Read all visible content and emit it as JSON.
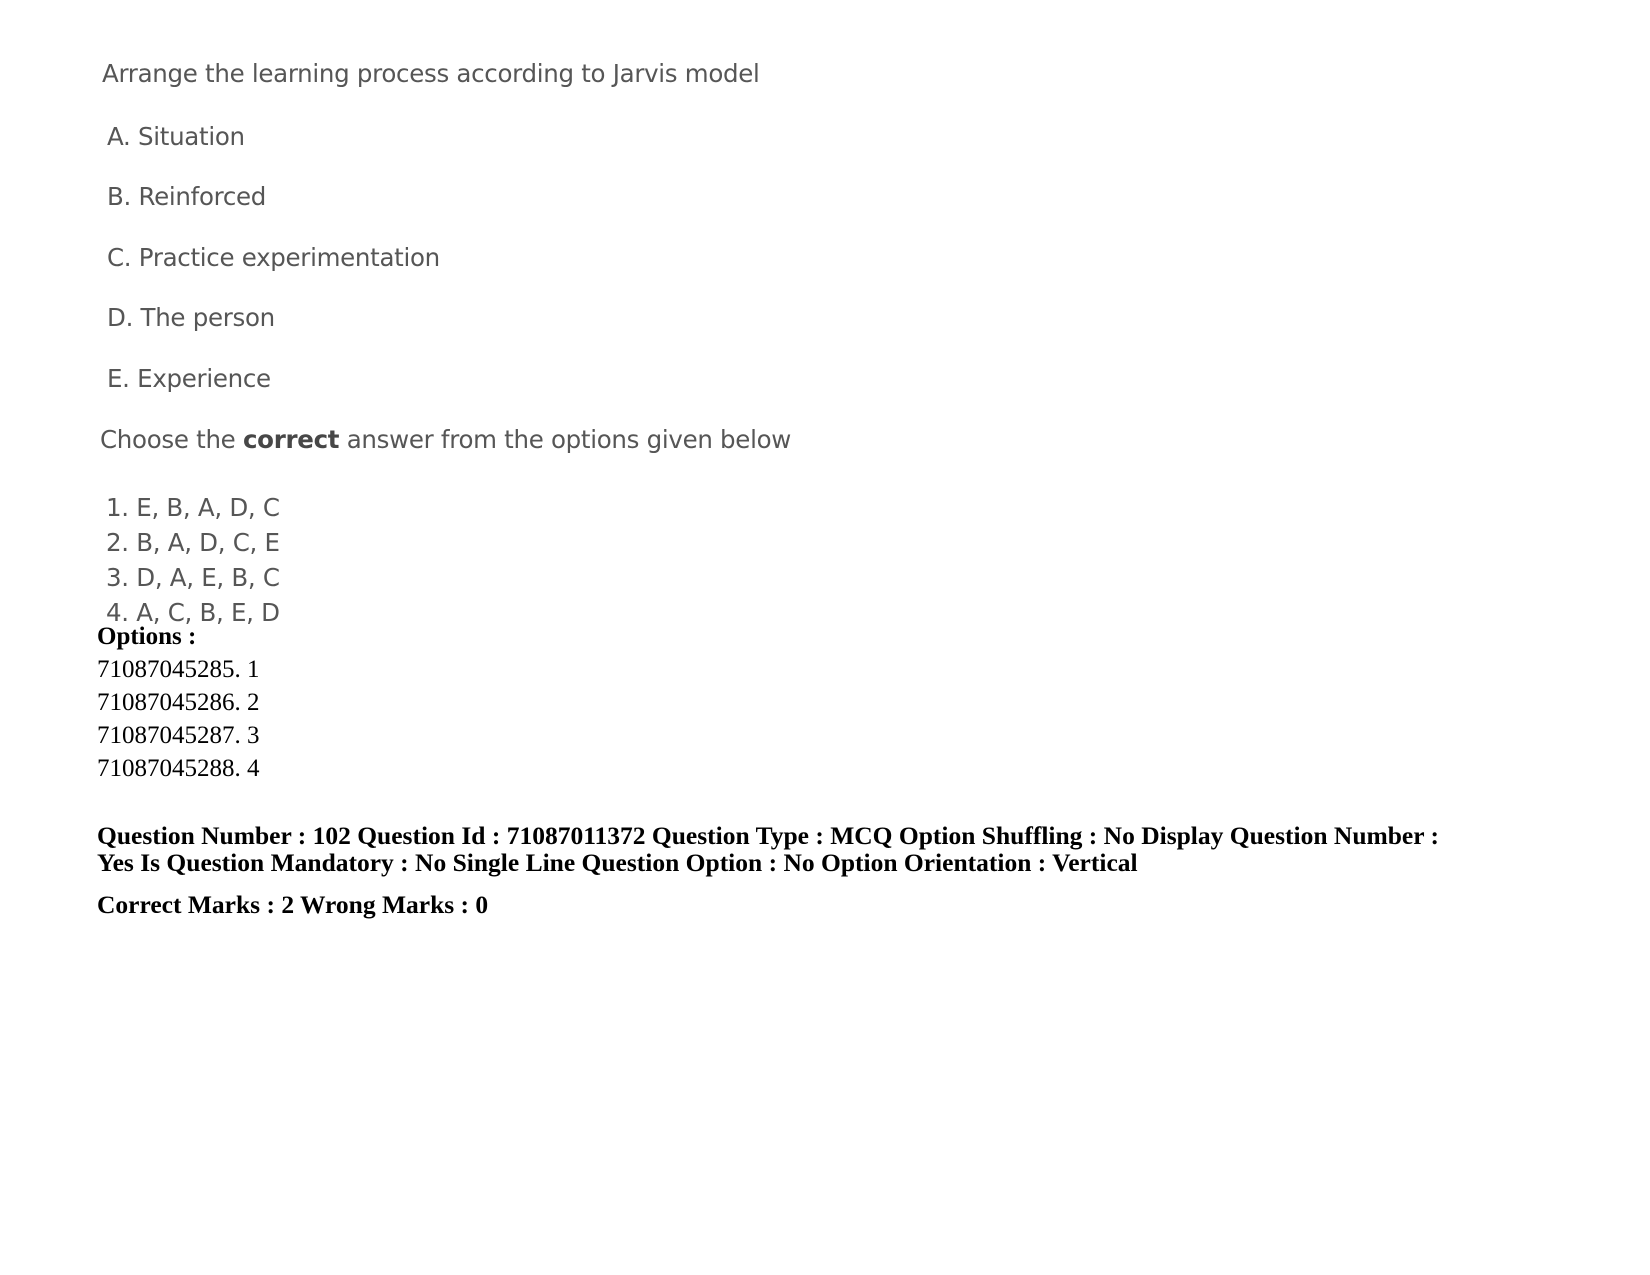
{
  "question": {
    "stem": "Arrange the learning process according to Jarvis model",
    "items": [
      "A. Situation",
      "B. Reinforced",
      "C. Practice experimentation",
      "D. The person",
      "E. Experience"
    ],
    "choose_prefix": "Choose the ",
    "choose_emphasis": "correct",
    "choose_suffix": " answer from the options given below",
    "answer_choices": [
      "1. E, B, A, D, C",
      "2. B, A, D, C, E",
      "3. D, A, E, B, C",
      "4. A, C, B, E, D"
    ]
  },
  "options_section": {
    "label": "Options :",
    "rows": [
      "71087045285. 1",
      "71087045286. 2",
      "71087045287. 3",
      "71087045288. 4"
    ]
  },
  "metadata": {
    "line1": "Question Number : 102 Question Id : 71087011372 Question Type : MCQ Option Shuffling : No Display Question Number : Yes Is Question Mandatory : No Single Line Question Option : No Option Orientation : Vertical",
    "line2": "Correct Marks : 2 Wrong Marks : 0"
  },
  "colors": {
    "page_background": "#ffffff",
    "scan_text": "#4a4a4a",
    "print_text": "#000000"
  }
}
